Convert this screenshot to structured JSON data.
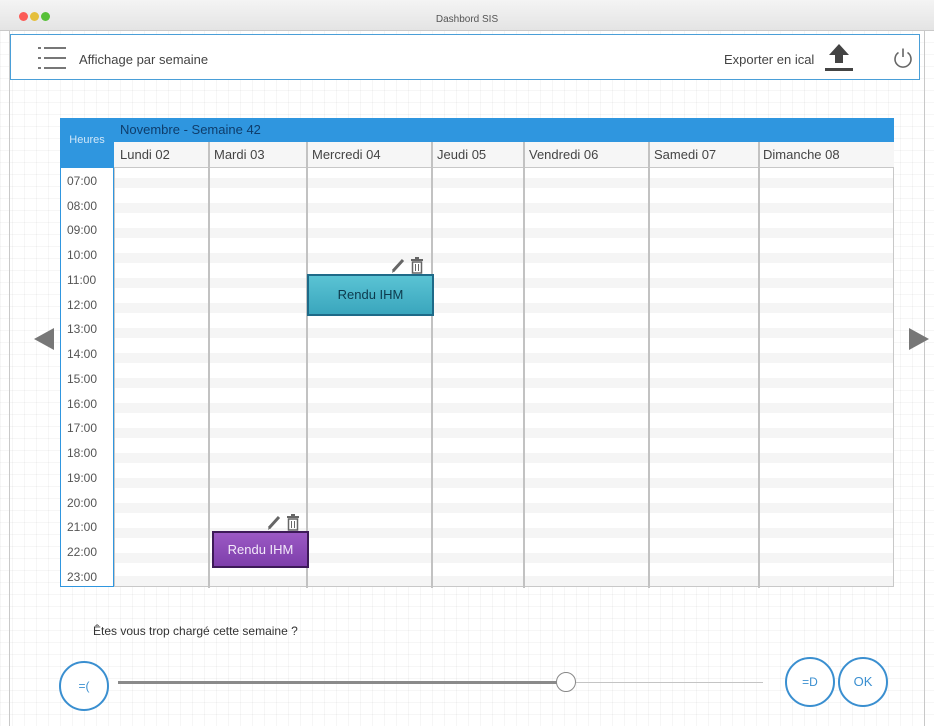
{
  "window": {
    "title": "Dashbord SIS"
  },
  "toolbar": {
    "menu_icon": "hamburger-list-icon",
    "view_label": "Affichage par semaine",
    "export_label": "Exporter en ical",
    "export_icon": "upload-icon",
    "power_icon": "power-icon"
  },
  "calendar": {
    "hours_header": "Heures",
    "month_week": "Novembre - Semaine 42",
    "days": [
      "Lundi 02",
      "Mardi 03",
      "Mercredi 04",
      "Jeudi 05",
      "Vendredi 06",
      "Samedi 07",
      "Dimanche 08"
    ],
    "hours": [
      "07:00",
      "08:00",
      "09:00",
      "10:00",
      "11:00",
      "12:00",
      "13:00",
      "14:00",
      "15:00",
      "16:00",
      "17:00",
      "18:00",
      "19:00",
      "20:00",
      "21:00",
      "22:00",
      "23:00"
    ],
    "events": [
      {
        "label": "Rendu IHM",
        "day": "Mercredi 04",
        "start": "11:00",
        "color": "#4bb8cc"
      },
      {
        "label": "Rendu IHM",
        "day": "Mardi 03",
        "start": "21:30",
        "color": "#8b4ab8"
      }
    ],
    "event_tool_icons": [
      "pencil-icon",
      "trash-icon"
    ],
    "nav": {
      "prev_icon": "triangle-left-icon",
      "next_icon": "triangle-right-icon"
    }
  },
  "feedback": {
    "question": "Êtes vous trop chargé cette semaine ?",
    "sad_label": "=(",
    "happy_label": "=D",
    "ok_label": "OK",
    "slider_level": 0.77
  },
  "colors": {
    "accent": "#2f96df",
    "teal_event": "#4bb8cc",
    "purple_event": "#8b4ab8"
  }
}
